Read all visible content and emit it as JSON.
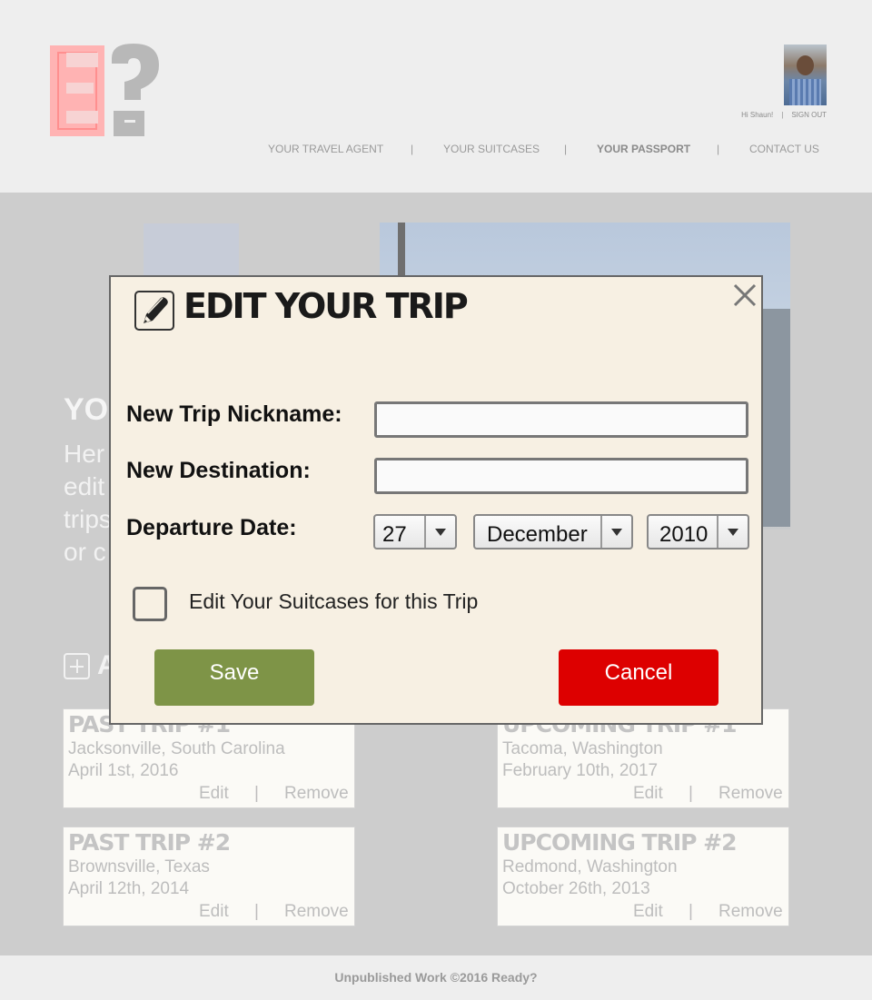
{
  "header": {
    "logo_text": "E?",
    "greeting": "Hi Shaun!",
    "user_sep": "|",
    "sign_out": "SIGN OUT",
    "nav_sep": "|",
    "nav": [
      "YOUR TRAVEL AGENT",
      "YOUR SUITCASES",
      "YOUR PASSPORT",
      "CONTACT US"
    ],
    "active_nav": "YOUR PASSPORT"
  },
  "background": {
    "heading": "YO",
    "text_lines": [
      "Her",
      "edit",
      "trips",
      "or c"
    ],
    "add_label": "A"
  },
  "trips": [
    {
      "title": "PAST TRIP #1",
      "place": "Jacksonville, South Carolina",
      "date": "April 1st, 2016"
    },
    {
      "title": "UPCOMING TRIP #1",
      "place": "Tacoma, Washington",
      "date": "February 10th, 2017"
    },
    {
      "title": "PAST TRIP #2",
      "place": "Brownsville, Texas",
      "date": "April 12th, 2014"
    },
    {
      "title": "UPCOMING TRIP #2",
      "place": "Redmond, Washington",
      "date": "October 26th, 2013"
    }
  ],
  "trip_actions": {
    "edit": "Edit",
    "sep": "|",
    "remove": "Remove"
  },
  "modal": {
    "title": "EDIT YOUR TRIP",
    "close_glyph": "×",
    "nickname_label": "New Trip Nickname:",
    "nickname_value": "",
    "destination_label": "New Destination:",
    "destination_value": "",
    "date_label": "Departure Date:",
    "day": "27",
    "month": "December",
    "year": "2010",
    "checkbox_label": "Edit Your Suitcases for this Trip",
    "save": "Save",
    "cancel": "Cancel"
  },
  "footer": {
    "text": "Unpublished Work ©2016 Ready?"
  },
  "colors": {
    "save": "#7e9447",
    "cancel": "#dd0000",
    "logo_e": "#ffb3b3",
    "logo_q": "#b8b8b8",
    "modal_bg": "#f7f0e3"
  }
}
